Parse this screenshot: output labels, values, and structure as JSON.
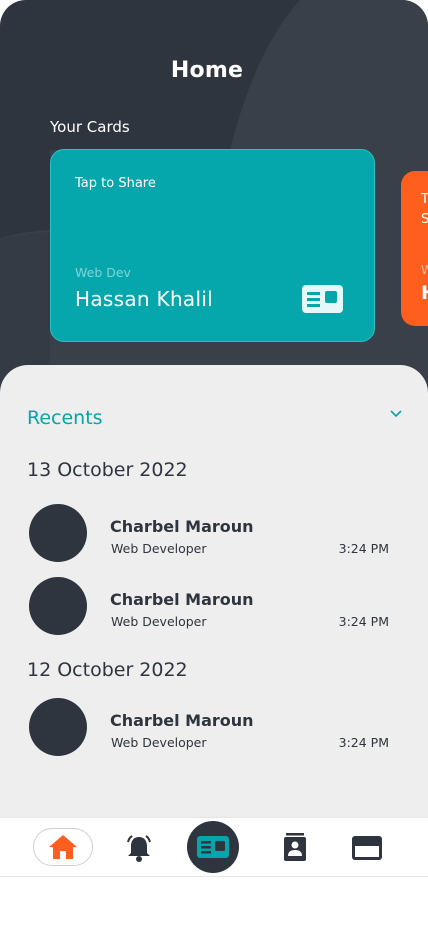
{
  "header": {
    "title": "Home"
  },
  "cards": {
    "section_label": "Your Cards",
    "primary": {
      "tap_text": "Tap to Share",
      "role": "Web Dev",
      "name": "Hassan Khalil",
      "color": "#05a7ad",
      "icon": "id-card-icon"
    },
    "secondary": {
      "tap_text": "T",
      "tap_text_2": "S",
      "role": "W",
      "name": "H",
      "color": "#fe5f1e"
    }
  },
  "recents": {
    "title": "Recents",
    "toggle_icon": "chevron-down-icon",
    "groups": [
      {
        "date": "13 October 2022",
        "items": [
          {
            "name": "Charbel Maroun",
            "job": "Web Developer",
            "time": "3:24 PM"
          },
          {
            "name": "Charbel Maroun",
            "job": "Web Developer",
            "time": "3:24 PM"
          }
        ]
      },
      {
        "date": "12 October 2022",
        "items": [
          {
            "name": "Charbel Maroun",
            "job": "Web Developer",
            "time": "3:24 PM"
          }
        ]
      }
    ]
  },
  "nav": {
    "items": [
      "home-icon",
      "bell-icon",
      "id-card-icon",
      "contacts-icon",
      "credit-card-icon"
    ],
    "active": "home-icon",
    "active_color": "#fe5f1e"
  },
  "colors": {
    "dark": "#2f353e",
    "accent": "#06a4ab",
    "orange": "#fe5f1e"
  }
}
